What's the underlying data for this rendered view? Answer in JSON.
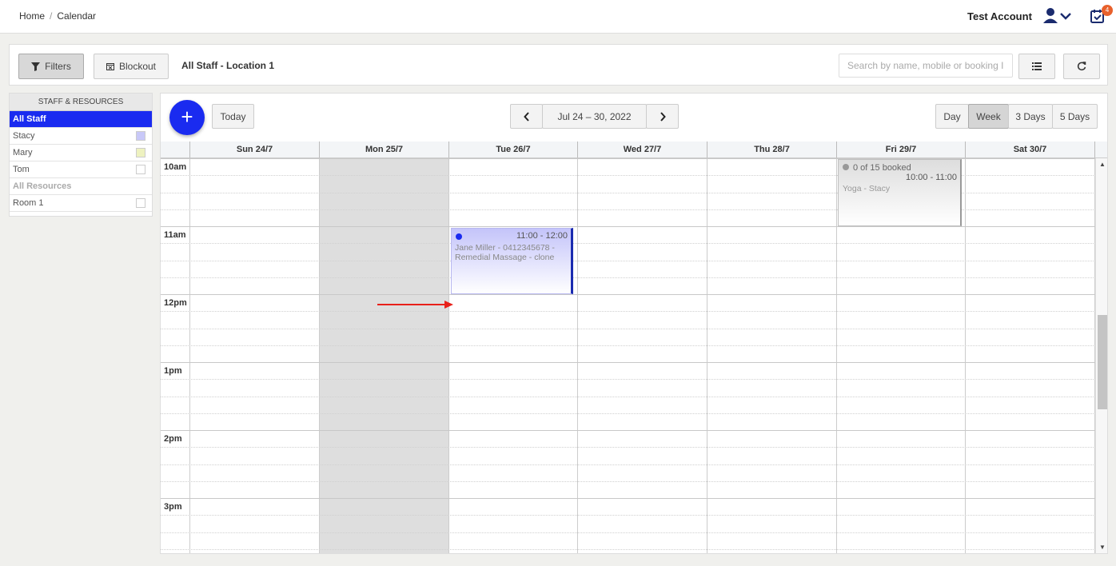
{
  "breadcrumb": {
    "home": "Home",
    "separator": "/",
    "current": "Calendar"
  },
  "header": {
    "account_name": "Test Account",
    "notification_count": "4"
  },
  "toolbar": {
    "filters_label": "Filters",
    "blockout_label": "Blockout",
    "location_title": "All Staff - Location 1",
    "search_placeholder": "Search by name, mobile or booking ID"
  },
  "sidebar": {
    "heading": "STAFF & RESOURCES",
    "items": [
      {
        "label": "All Staff",
        "active": true
      },
      {
        "label": "Stacy",
        "color": "#c8c8f8"
      },
      {
        "label": "Mary",
        "color": "#eef2c0"
      },
      {
        "label": "Tom",
        "color": "#ffffff"
      }
    ],
    "resources_heading": "All Resources",
    "resources": [
      {
        "label": "Room 1",
        "color": "#ffffff"
      }
    ]
  },
  "calendar": {
    "today_label": "Today",
    "date_range": "Jul 24 – 30, 2022",
    "views": [
      "Day",
      "Week",
      "3 Days",
      "5 Days"
    ],
    "active_view": "Week",
    "days": [
      "Sun 24/7",
      "Mon 25/7",
      "Tue 26/7",
      "Wed 27/7",
      "Thu 28/7",
      "Fri 29/7",
      "Sat 30/7"
    ],
    "time_labels": [
      "10am",
      "11am",
      "12pm",
      "1pm",
      "2pm",
      "3pm"
    ],
    "events": [
      {
        "time": "11:00 - 12:00",
        "description": "Jane Miller - 0412345678 - Remedial Massage - clone",
        "color": "#1a2bf0"
      },
      {
        "booked": "0 of 15 booked",
        "time": "10:00 - 11:00",
        "description": "Yoga - Stacy",
        "color": "#999999"
      }
    ]
  }
}
